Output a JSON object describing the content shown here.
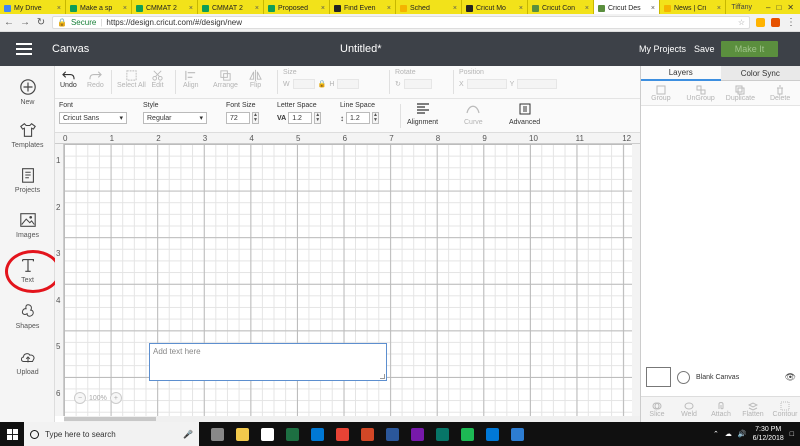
{
  "browser": {
    "tabs": [
      {
        "label": "My Drive",
        "color": "#4285f4"
      },
      {
        "label": "Make a sp",
        "color": "#0f9d58"
      },
      {
        "label": "CMMAT 2",
        "color": "#0f9d58"
      },
      {
        "label": "CMMAT 2",
        "color": "#0f9d58"
      },
      {
        "label": "Proposed",
        "color": "#0f9d58"
      },
      {
        "label": "Find Even",
        "color": "#222222"
      },
      {
        "label": "Sched",
        "color": "#f4b400"
      },
      {
        "label": "Cricut Mo",
        "color": "#222222"
      },
      {
        "label": "Cricut Con",
        "color": "#5b8f3e"
      },
      {
        "label": "Cricut Des",
        "color": "#5b8f3e",
        "active": true
      },
      {
        "label": "News | Cri",
        "color": "#f4b400"
      }
    ],
    "user": "Tiffany",
    "secure_label": "Secure",
    "url": "https://design.cricut.com/#/design/new"
  },
  "header": {
    "section": "Canvas",
    "doc_title": "Untitled*",
    "my_projects": "My Projects",
    "save": "Save",
    "make_it": "Make It"
  },
  "sidebar": {
    "items": [
      {
        "label": "New",
        "icon": "plus-circle-icon"
      },
      {
        "label": "Templates",
        "icon": "shirt-icon"
      },
      {
        "label": "Projects",
        "icon": "projects-icon"
      },
      {
        "label": "Images",
        "icon": "image-icon"
      },
      {
        "label": "Text",
        "icon": "text-icon",
        "highlighted": true
      },
      {
        "label": "Shapes",
        "icon": "shapes-icon"
      },
      {
        "label": "Upload",
        "icon": "upload-cloud-icon"
      }
    ]
  },
  "toolbar": {
    "undo": "Undo",
    "redo": "Redo",
    "select_all": "Select All",
    "edit": "Edit",
    "align": "Align",
    "arrange": "Arrange",
    "flip": "Flip",
    "size": "Size",
    "size_w": "W",
    "size_h": "H",
    "rotate": "Rotate",
    "position": "Position",
    "pos_x": "X",
    "pos_y": "Y"
  },
  "text_toolbar": {
    "font_label": "Font",
    "font_value": "Cricut Sans",
    "style_label": "Style",
    "style_value": "Regular",
    "font_size_label": "Font Size",
    "font_size_value": "72",
    "letter_space_label": "Letter Space",
    "letter_space_value": "1.2",
    "line_space_label": "Line Space",
    "line_space_value": "1.2",
    "alignment": "Alignment",
    "curve": "Curve",
    "advanced": "Advanced"
  },
  "canvas": {
    "ruler_top": [
      "0",
      "1",
      "2",
      "3",
      "4",
      "5",
      "6",
      "7",
      "8",
      "9",
      "10",
      "11",
      "12"
    ],
    "ruler_left": [
      "1",
      "2",
      "3",
      "4",
      "5",
      "6"
    ],
    "text_placeholder": "Add text here",
    "zoom": "100%"
  },
  "right_panel": {
    "tabs": [
      "Layers",
      "Color Sync"
    ],
    "tools": [
      "Group",
      "UnGroup",
      "Duplicate",
      "Delete"
    ],
    "blank_canvas": "Blank Canvas",
    "bottom_tools": [
      "Slice",
      "Weld",
      "Attach",
      "Flatten",
      "Contour"
    ]
  },
  "taskbar": {
    "search_placeholder": "Type here to search",
    "time": "7:30 PM",
    "date": "6/12/2018"
  },
  "colors": {
    "header_bg": "#3d4148",
    "make_it_green": "#5b8f3e",
    "highlight_ring": "#e3141c",
    "tab_strip": "#f2e21a"
  }
}
